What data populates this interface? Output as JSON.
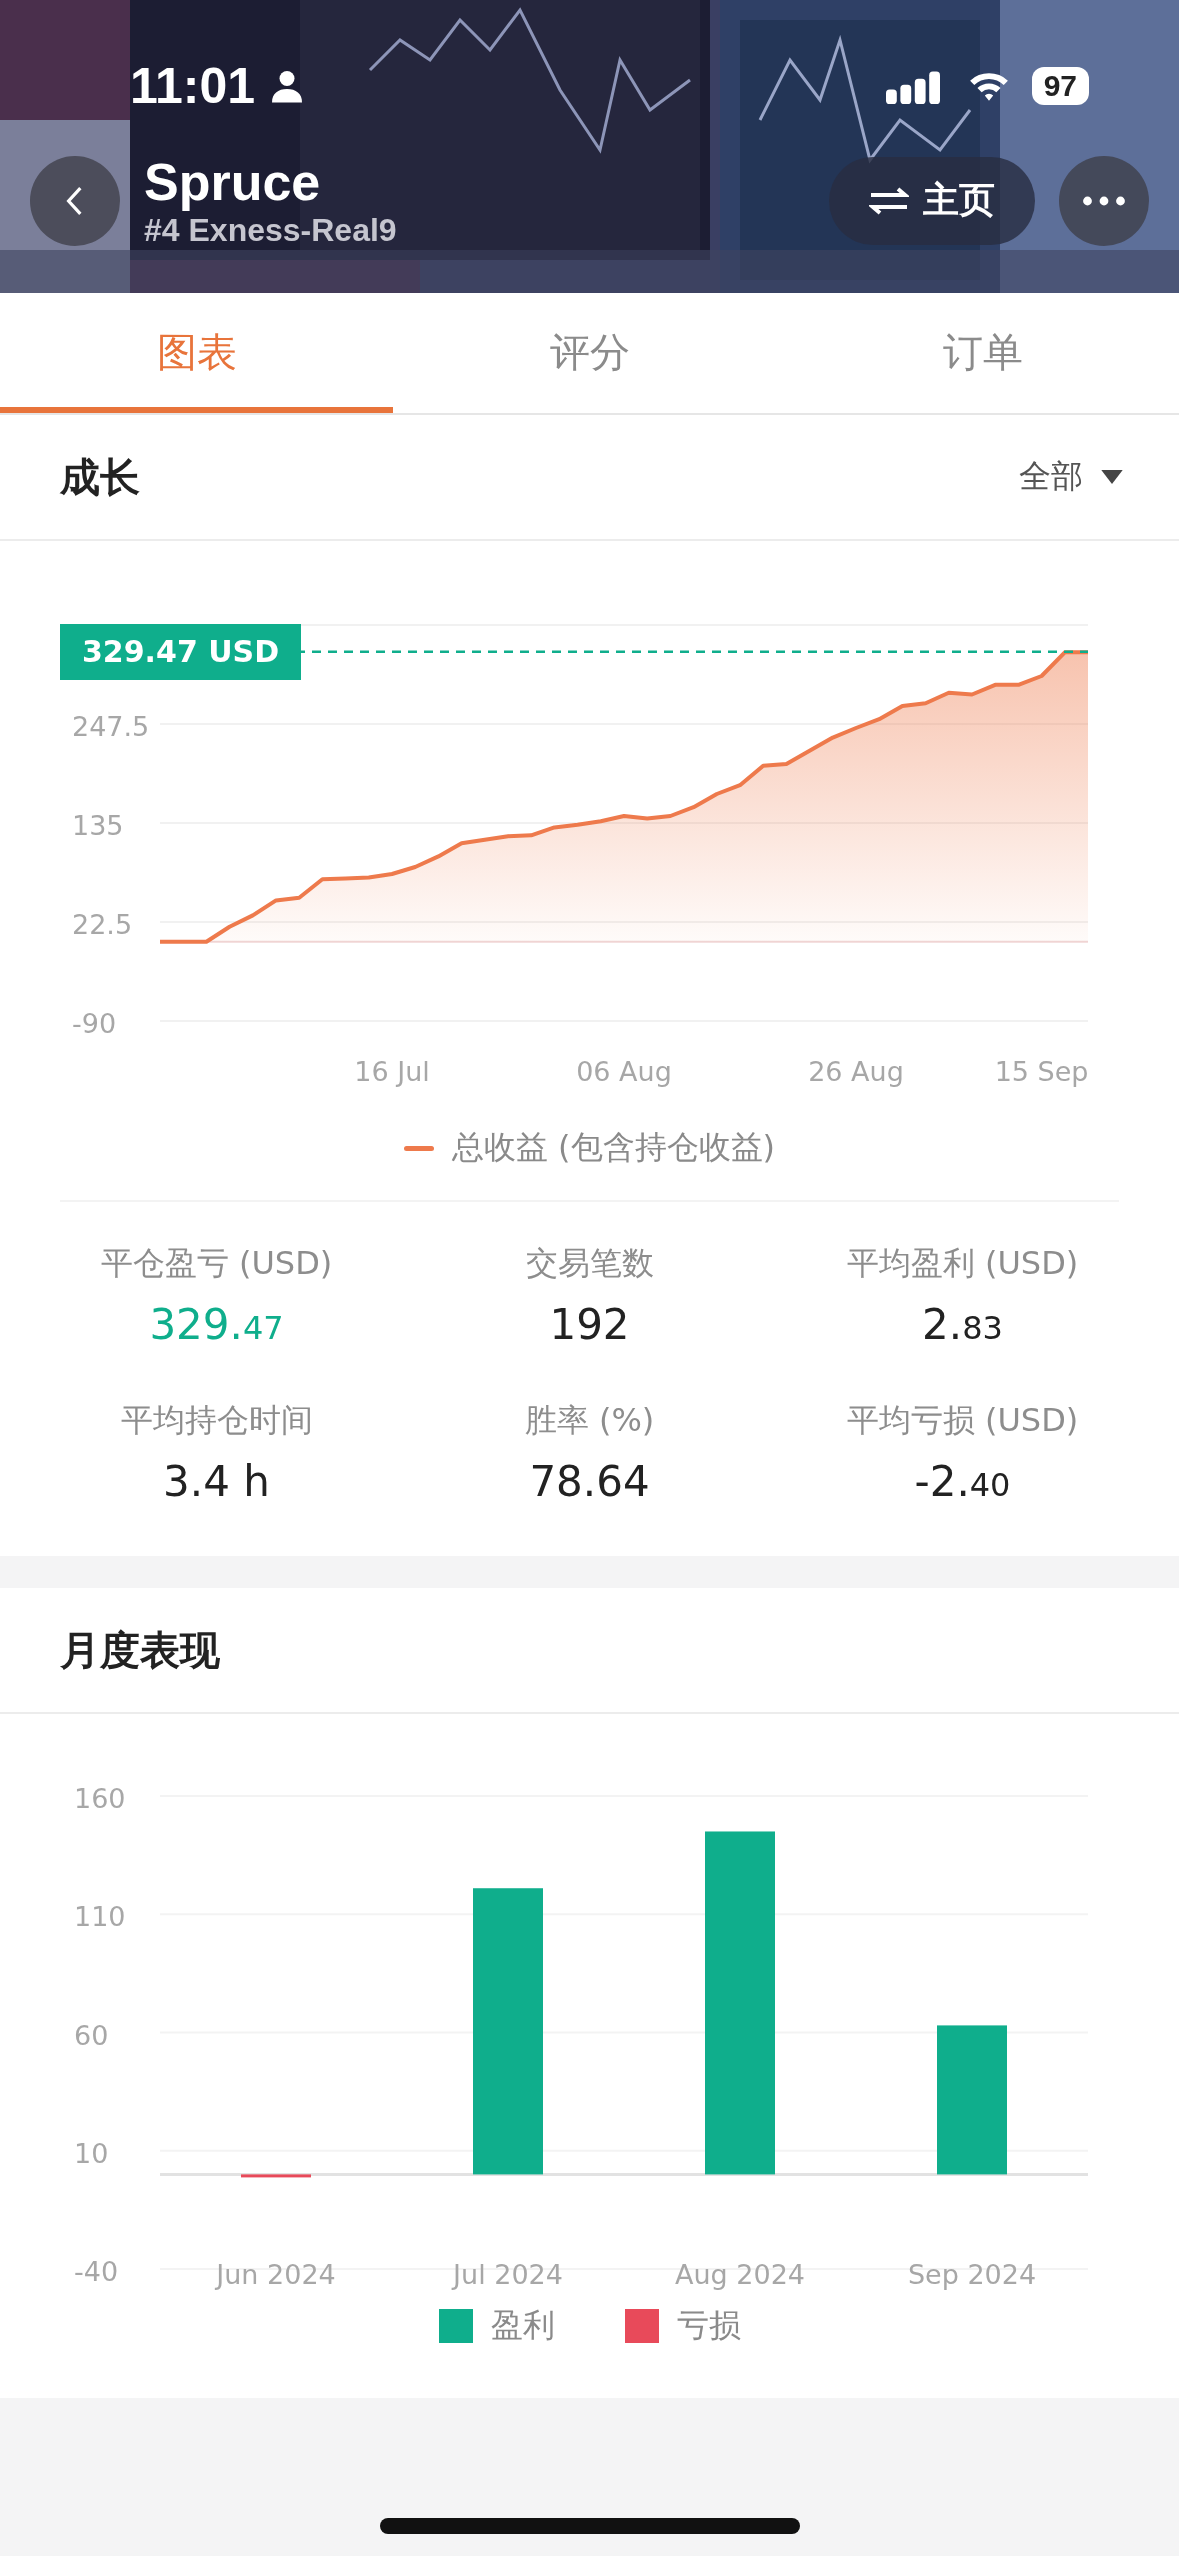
{
  "status_bar": {
    "time": "11:01",
    "battery": "97"
  },
  "header": {
    "title": "Spruce",
    "subtitle": "#4 Exness-Real9",
    "home_button": "主页"
  },
  "tabs": [
    {
      "label": "图表",
      "selected": true
    },
    {
      "label": "评分",
      "selected": false
    },
    {
      "label": "订单",
      "selected": false
    }
  ],
  "growth": {
    "title": "成长",
    "filter": "全部",
    "chart_data": {
      "type": "area",
      "categories": [
        null,
        null,
        null,
        null,
        null,
        null,
        null,
        null,
        null,
        null,
        "16 Jul",
        null,
        null,
        null,
        null,
        null,
        null,
        null,
        null,
        null,
        "06 Aug",
        null,
        null,
        null,
        null,
        null,
        null,
        null,
        null,
        null,
        "26 Aug",
        null,
        null,
        null,
        null,
        null,
        null,
        null,
        "15 Sep",
        null,
        null
      ],
      "series": [
        {
          "name": "总收益 (包含持仓收益)",
          "color": "#ee7a4c",
          "values": [
            0,
            0,
            0,
            17,
            30,
            47,
            50,
            71,
            72,
            73,
            77,
            85,
            97,
            112,
            116,
            120,
            121,
            130,
            133,
            137,
            143,
            140,
            143,
            153,
            168,
            178,
            200,
            202,
            217,
            232,
            243,
            253,
            268,
            271,
            283,
            281,
            292,
            292,
            302,
            329,
            329
          ]
        }
      ],
      "ylim": [
        -90,
        360
      ],
      "yticks": [
        -90,
        22.5,
        135,
        247.5
      ],
      "grid": true,
      "ref_lines": [
        {
          "axis": "y",
          "value": 329.47,
          "color": "#0fae8c",
          "label": "329.47 USD"
        }
      ]
    }
  },
  "stats": [
    {
      "label": "平仓盈亏 (USD)",
      "value": "329.47",
      "kind": "split",
      "color": "#0fae8c"
    },
    {
      "label": "交易笔数",
      "value": "192",
      "kind": "plain",
      "color": "#222222"
    },
    {
      "label": "平均盈利 (USD)",
      "value": "2.83",
      "kind": "split",
      "color": "#222222"
    },
    {
      "label": "平均持仓时间",
      "value": "3.4 h",
      "kind": "plain",
      "color": "#222222"
    },
    {
      "label": "胜率 (%)",
      "value": "78.64",
      "kind": "plain",
      "color": "#222222"
    },
    {
      "label": "平均亏损 (USD)",
      "value": "-2.40",
      "kind": "split",
      "color": "#222222"
    }
  ],
  "monthly": {
    "title": "月度表现",
    "chart_data": {
      "type": "bar",
      "categories": [
        "Jun 2024",
        "Jul 2024",
        "Aug 2024",
        "Sep 2024"
      ],
      "series": [
        {
          "name": "盈利",
          "color": "#0fae8c",
          "values": [
            null,
            121,
            145,
            63
          ]
        },
        {
          "name": "亏损",
          "color": "#e84a5a",
          "values": [
            -1,
            null,
            null,
            null
          ]
        }
      ],
      "ylim": [
        -40,
        160
      ],
      "yticks": [
        -40,
        10,
        60,
        110,
        160
      ],
      "stacked": true,
      "grid": true
    }
  }
}
